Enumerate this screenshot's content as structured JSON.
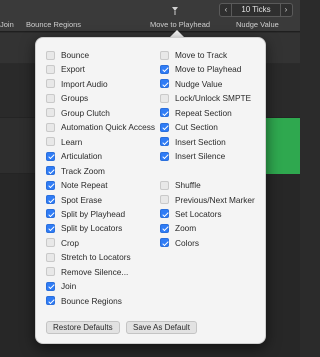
{
  "toolbar": {
    "join_label": "Join",
    "bounce_regions_label": "Bounce Regions",
    "move_to_playhead_label": "Move to Playhead",
    "nudge_value_label": "Nudge Value",
    "nudge_value": "10 Ticks"
  },
  "popup": {
    "left_items": [
      {
        "label": "Bounce",
        "checked": false
      },
      {
        "label": "Export",
        "checked": false
      },
      {
        "label": "Import Audio",
        "checked": false
      },
      {
        "label": "Groups",
        "checked": false
      },
      {
        "label": "Group Clutch",
        "checked": false
      },
      {
        "label": "Automation Quick Access",
        "checked": false
      },
      {
        "label": "Learn",
        "checked": false
      },
      {
        "label": "Articulation",
        "checked": true
      },
      {
        "label": "Track Zoom",
        "checked": true
      },
      {
        "label": "Note Repeat",
        "checked": true
      },
      {
        "label": "Spot Erase",
        "checked": true
      },
      {
        "label": "Split by Playhead",
        "checked": true
      },
      {
        "label": "Split by Locators",
        "checked": true
      },
      {
        "label": "Crop",
        "checked": false
      },
      {
        "label": "Stretch to Locators",
        "checked": false
      },
      {
        "label": "Remove Silence...",
        "checked": false
      },
      {
        "label": "Join",
        "checked": true
      },
      {
        "label": "Bounce Regions",
        "checked": true
      }
    ],
    "right_items": [
      {
        "label": "Move to Track",
        "checked": false
      },
      {
        "label": "Move to Playhead",
        "checked": true
      },
      {
        "label": "Nudge Value",
        "checked": true
      },
      {
        "label": "Lock/Unlock SMPTE",
        "checked": false
      },
      {
        "label": "Repeat Section",
        "checked": true
      },
      {
        "label": "Cut Section",
        "checked": true
      },
      {
        "label": "Insert Section",
        "checked": true
      },
      {
        "label": "Insert Silence",
        "checked": true
      },
      {
        "label": "Shuffle",
        "checked": false
      },
      {
        "label": "Previous/Next Marker",
        "checked": false
      },
      {
        "label": "Set Locators",
        "checked": true
      },
      {
        "label": "Zoom",
        "checked": true
      },
      {
        "label": "Colors",
        "checked": true
      }
    ],
    "restore_defaults_label": "Restore Defaults",
    "save_as_default_label": "Save As Default"
  }
}
